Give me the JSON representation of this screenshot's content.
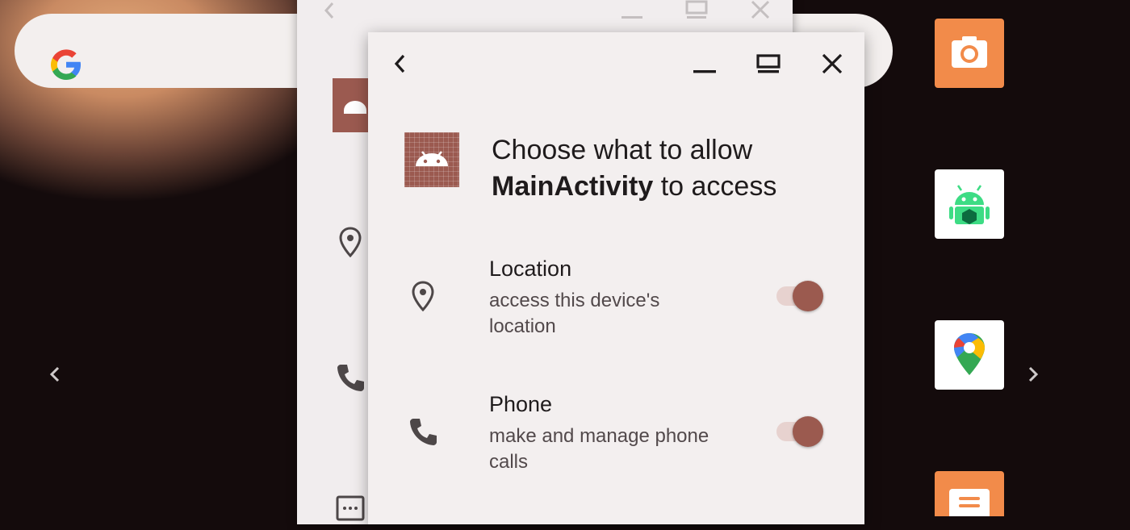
{
  "launcher": {
    "search_logo": "G",
    "apps": [
      {
        "icon": "camera-icon",
        "color": "#f28b4a"
      },
      {
        "icon": "android-app-icon",
        "color": "#ffffff"
      },
      {
        "icon": "maps-icon",
        "color": "#ffffff"
      },
      {
        "icon": "messages-icon",
        "color": "#f28b4a"
      }
    ]
  },
  "dialog": {
    "title_prefix": "Choose what to allow",
    "app_name": "MainActivity",
    "title_suffix": "to access",
    "permissions": [
      {
        "name": "Location",
        "description": "access this device's location",
        "icon": "location-icon",
        "enabled": true
      },
      {
        "name": "Phone",
        "description": "make and manage phone calls",
        "icon": "phone-icon",
        "enabled": true
      }
    ]
  },
  "colors": {
    "accent": "#9b5a4f",
    "dialog_bg": "#f3efef",
    "wallpaper": "#140b0c"
  }
}
